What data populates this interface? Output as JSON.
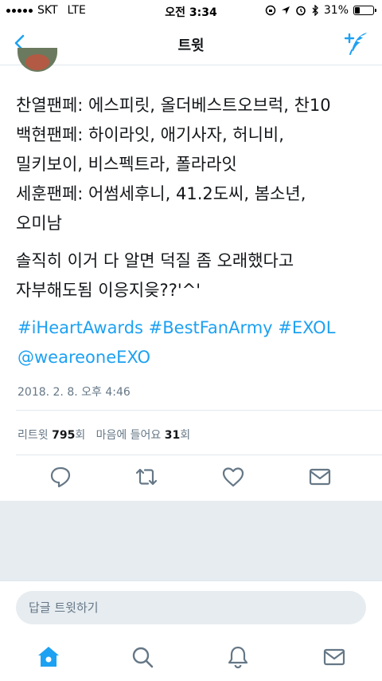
{
  "status_bar": {
    "carrier": "SKT",
    "network": "LTE",
    "time": "오전 3:34",
    "battery_percent": "31%",
    "battery_level": 0.31
  },
  "nav": {
    "title": "트윗",
    "accent_color": "#1da1f2"
  },
  "tweet": {
    "lines": [
      "찬열팬페: 에스피릿, 올더베스트오브럭, 찬10",
      "백현팬페: 하이라잇, 애기사자, 허니비,",
      "밀키보이, 비스펙트라, 폴라라잇",
      "세훈팬페: 어썸세후니, 41.2도씨, 봄소년,",
      "오미남",
      "솔직히 이거 다 알면 덕질 좀 오래했다고",
      "자부해도됨 이응지읒??'^'"
    ],
    "links": [
      "#iHeartAwards #BestFanArmy #EXOL",
      "@weareoneEXO"
    ],
    "timestamp": "2018. 2. 8. 오후 4:46",
    "stats": {
      "retweet_label": "리트윗",
      "retweet_count": "795",
      "retweet_unit": "회",
      "like_label": "마음에 들어요",
      "like_count": "31",
      "like_unit": "회"
    }
  },
  "actions": {
    "icons": [
      "reply-icon",
      "retweet-icon",
      "like-icon",
      "dm-icon"
    ]
  },
  "reply": {
    "placeholder": "답글 트윗하기"
  },
  "tabs": [
    "home-icon",
    "search-icon",
    "notifications-icon",
    "messages-icon"
  ]
}
